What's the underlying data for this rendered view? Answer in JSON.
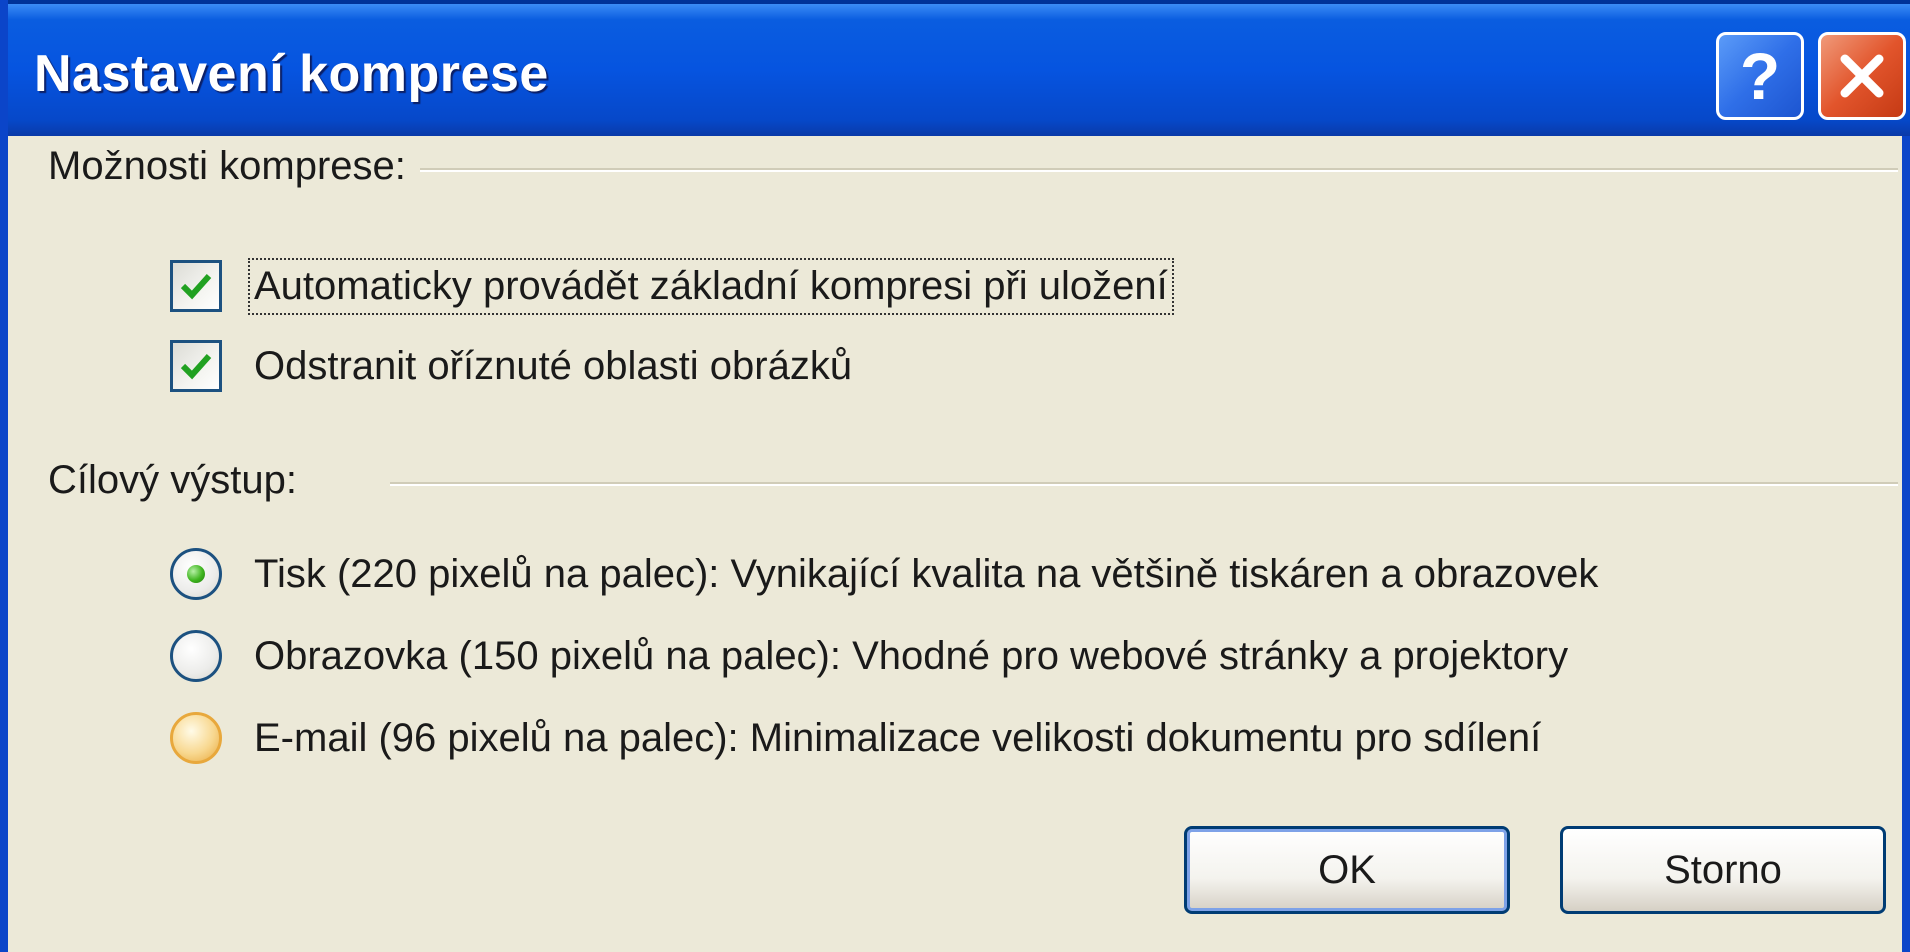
{
  "window": {
    "title": "Nastavení komprese",
    "help_label": "?",
    "close_label": "✕"
  },
  "compression_options": {
    "heading": "Možnosti komprese:",
    "items": [
      {
        "label": "Automaticky provádět základní kompresi při uložení",
        "checked": true,
        "focused": true
      },
      {
        "label": "Odstranit oříznuté oblasti obrázků",
        "checked": true
      }
    ]
  },
  "target_output": {
    "heading": "Cílový výstup:",
    "items": [
      {
        "label": "Tisk (220 pixelů na palec): Vynikající kvalita na většině tiskáren a obrazovek",
        "selected": true
      },
      {
        "label": "Obrazovka (150 pixelů na palec): Vhodné pro webové stránky a projektory",
        "selected": false
      },
      {
        "label": "E-mail (96 pixelů na palec): Minimalizace velikosti dokumentu pro sdílení",
        "selected": false,
        "hover": true
      }
    ]
  },
  "buttons": {
    "ok_label": "OK",
    "cancel_label": "Storno"
  },
  "colors": {
    "title_bar": "#0654e0",
    "dialog_bg": "#ece9d8",
    "check_mark": "#21a121",
    "radio_selected": "#3fb51f"
  }
}
